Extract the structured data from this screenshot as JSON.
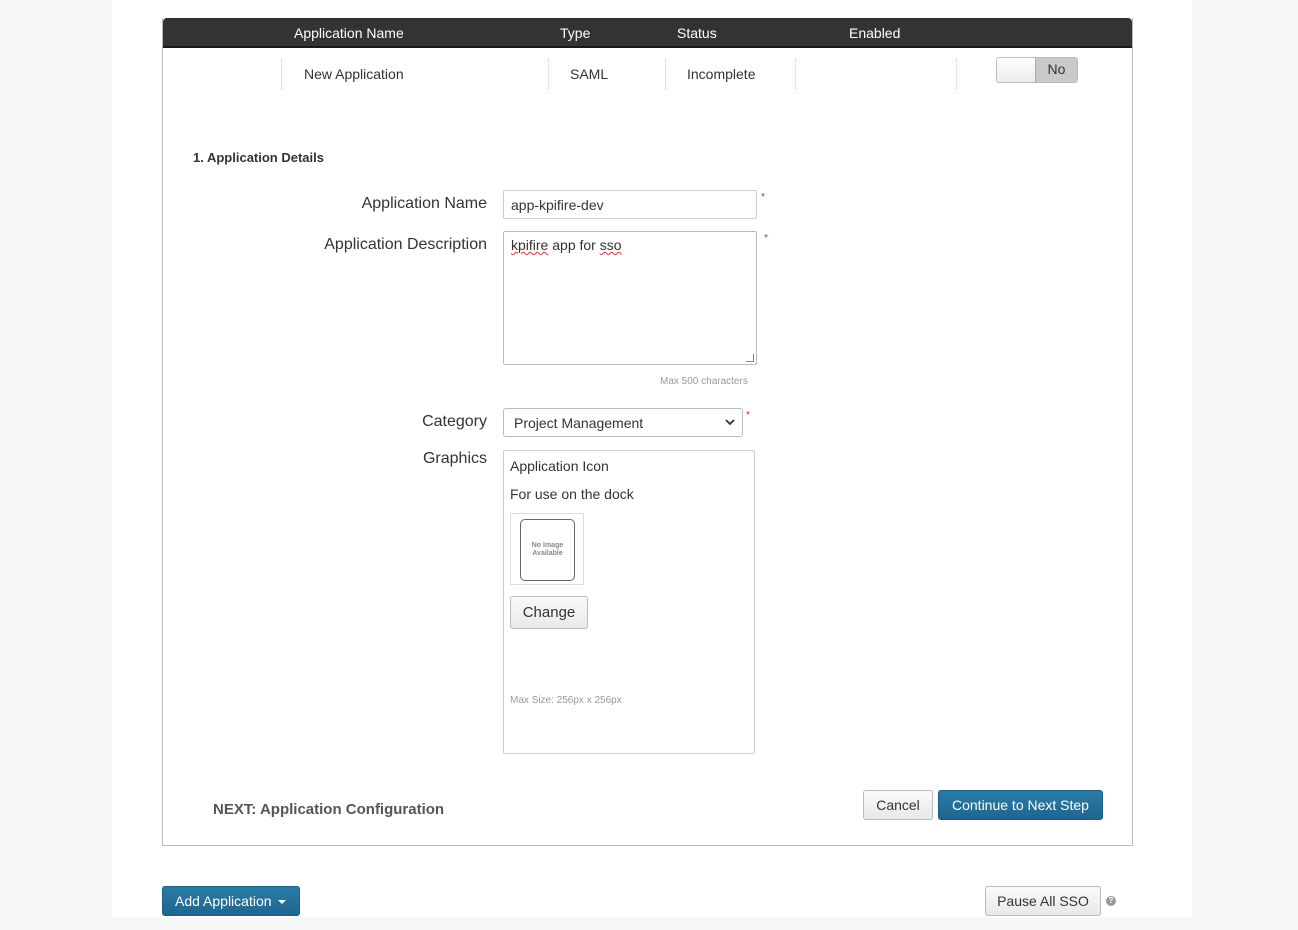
{
  "table": {
    "headers": [
      "Application Name",
      "Type",
      "Status",
      "Enabled"
    ],
    "row": {
      "name": "New Application",
      "type": "SAML",
      "status": "Incomplete",
      "enabled_label": "No"
    }
  },
  "form": {
    "section_title": "1. Application Details",
    "name_label": "Application Name",
    "name_value": "app-kpifire-dev",
    "description_label": "Application Description",
    "description_value_word1": "kpifire",
    "description_value_mid": " app for ",
    "description_value_word2": "sso",
    "description_hint": "Max 500 characters",
    "category_label": "Category",
    "category_value": "Project Management",
    "graphics_label": "Graphics",
    "graphics": {
      "title": "Application Icon",
      "subtitle": "For use on the dock",
      "placeholder_line1": "No Image",
      "placeholder_line2": "Available",
      "change_label": "Change",
      "max_size": "Max Size: 256px x 256px"
    },
    "required_mark": "*",
    "next_label": "NEXT: Application Configuration",
    "cancel_label": "Cancel",
    "continue_label": "Continue to Next Step"
  },
  "footer": {
    "add_application_label": "Add Application",
    "pause_label": "Pause All SSO",
    "help_glyph": "?"
  },
  "colors": {
    "header_bg": "#333333",
    "primary_button": "#1e6690",
    "required": "#c0392b"
  }
}
